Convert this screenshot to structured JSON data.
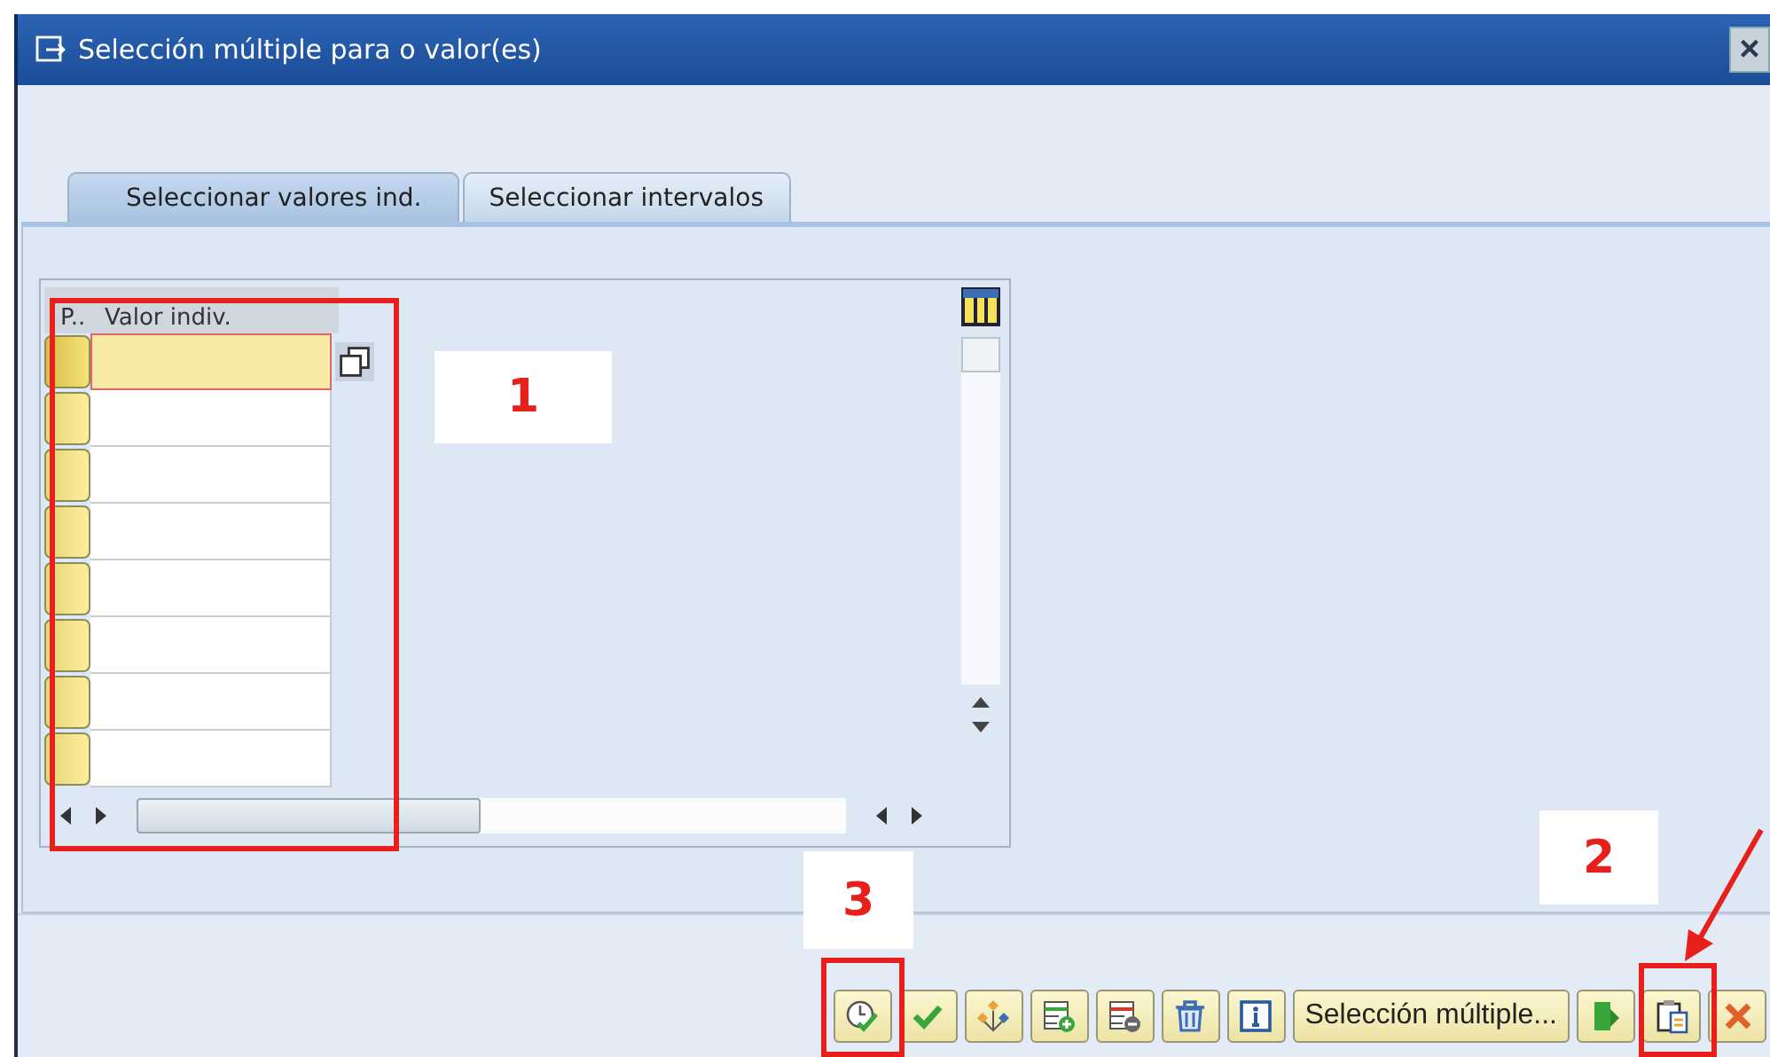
{
  "window": {
    "title": "Selección múltiple para o valor(es)",
    "close": "×"
  },
  "tabs": [
    {
      "label": "Seleccionar valores ind.",
      "selected": true
    },
    {
      "label": "Seleccionar intervalos",
      "selected": false
    }
  ],
  "table": {
    "columns": [
      "P..",
      "Valor indiv."
    ],
    "rows": [
      {
        "selected": true
      },
      {
        "selected": false
      },
      {
        "selected": false
      },
      {
        "selected": false
      },
      {
        "selected": false
      },
      {
        "selected": false
      },
      {
        "selected": false
      },
      {
        "selected": false
      }
    ]
  },
  "toolbar": [
    {
      "kind": "execute"
    },
    {
      "kind": "check"
    },
    {
      "kind": "diamonds"
    },
    {
      "kind": "insert"
    },
    {
      "kind": "delete"
    },
    {
      "kind": "trash"
    },
    {
      "kind": "info"
    },
    {
      "kind": "text",
      "label": "Selección múltiple..."
    },
    {
      "kind": "import"
    },
    {
      "kind": "paste"
    },
    {
      "kind": "cancel"
    }
  ],
  "annotations": [
    {
      "label": "1"
    },
    {
      "label": "2"
    },
    {
      "label": "3"
    }
  ]
}
